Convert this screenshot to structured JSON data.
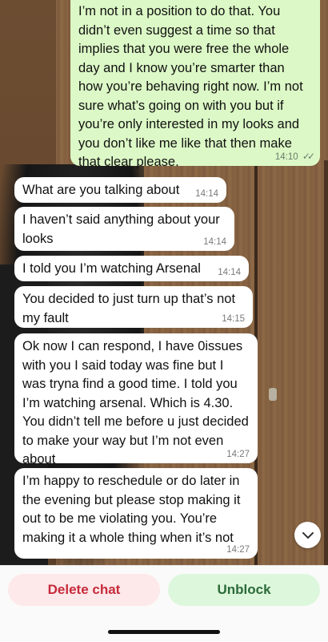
{
  "colors": {
    "outgoing_bubble": "#dcf8c6",
    "incoming_bubble": "#ffffff",
    "delete_text": "#c62b3b",
    "unblock_text": "#2c6a3a"
  },
  "messages": [
    {
      "direction": "out",
      "text": "I’m not in a position to do that. You didn’t even suggest a time so that implies that you were free the whole day and I know you’re smarter than how you’re behaving right now. I’m not sure what’s going on with you but if you’re only interested in my looks and you don’t like me like that then make that clear please.",
      "time": "14:10",
      "status": "read"
    },
    {
      "direction": "in",
      "text": "What are you talking about",
      "time": "14:14"
    },
    {
      "direction": "in",
      "text": "I haven’t said anything about your looks",
      "time": "14:14"
    },
    {
      "direction": "in",
      "text": "I told you I’m watching Arsenal",
      "time": "14:14"
    },
    {
      "direction": "in",
      "text": "You decided to just turn up that’s not my fault",
      "time": "14:15"
    },
    {
      "direction": "in",
      "text": "Ok now I can respond, I have 0issues with you I said today was fine but I was tryna find a good time. I told you I’m watching arsenal. Which is 4.30. You didn’t tell me before u just decided to make your way but I’m not even about",
      "time": "14:27"
    },
    {
      "direction": "in",
      "text": "I’m happy to reschedule or do later in the evening but please stop making it out to be me violating you. You’re making it a whole thing when it’s not",
      "time": "14:27"
    }
  ],
  "actions": {
    "delete_label": "Delete chat",
    "unblock_label": "Unblock"
  },
  "icons": {
    "read_receipt": "double-check-icon",
    "scroll_down": "chevron-down-icon"
  }
}
